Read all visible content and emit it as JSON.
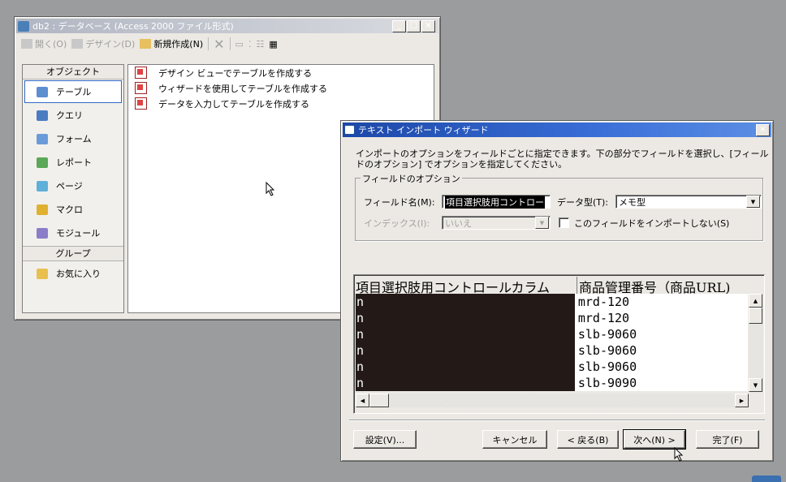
{
  "db_window": {
    "title": "db2 : データベース (Access 2000 ファイル形式)",
    "toolbar": {
      "open": "開く(O)",
      "design": "デザイン(D)",
      "new": "新規作成(N)"
    },
    "sidebar": {
      "header": "オブジェクト",
      "items": [
        {
          "label": "テーブル"
        },
        {
          "label": "クエリ"
        },
        {
          "label": "フォーム"
        },
        {
          "label": "レポート"
        },
        {
          "label": "ページ"
        },
        {
          "label": "マクロ"
        },
        {
          "label": "モジュール"
        }
      ],
      "group_header": "グループ",
      "favorites": "お気に入り"
    },
    "list": [
      "デザイン ビューでテーブルを作成する",
      "ウィザードを使用してテーブルを作成する",
      "データを入力してテーブルを作成する"
    ]
  },
  "wizard": {
    "title": "テキスト インポート ウィザード",
    "description": "インポートのオプションをフィールドごとに指定できます。下の部分でフィールドを選択し、[フィールドのオプション] でオプションを指定してください。",
    "group_label": "フィールドのオプション",
    "field_name_label": "フィールド名(M):",
    "field_name_value": "項目選択肢用コントロー",
    "data_type_label": "データ型(T):",
    "data_type_value": "メモ型",
    "index_label": "インデックス(I):",
    "index_value": "いいえ",
    "skip_label": "このフィールドをインポートしない(S)",
    "preview": {
      "headers": [
        "項目選択肢用コントロールカラム",
        "商品管理番号（商品URL)"
      ],
      "rows": [
        [
          "n",
          "mrd-120"
        ],
        [
          "n",
          "mrd-120"
        ],
        [
          "n",
          "slb-9060"
        ],
        [
          "n",
          "slb-9060"
        ],
        [
          "n",
          "slb-9060"
        ],
        [
          "n",
          "slb-9090"
        ]
      ]
    },
    "buttons": {
      "settings": "設定(V)...",
      "cancel": "キャンセル",
      "back": "< 戻る(B)",
      "next": "次へ(N) >",
      "finish": "完了(F)"
    }
  }
}
